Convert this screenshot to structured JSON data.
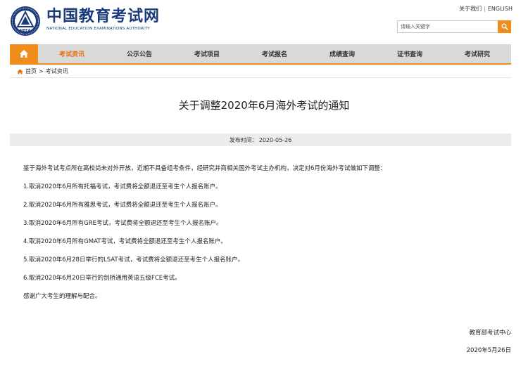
{
  "brand": {
    "name_cn": "中国教育考试网",
    "name_en": "NATIONAL EDUCATION EXAMINATIONS AUTHORITY",
    "logo_initials": "NEEA"
  },
  "toplinks": {
    "about": "关于我们",
    "separator": "|",
    "english": "ENGLISH"
  },
  "search": {
    "placeholder": "请输入关键字"
  },
  "nav": {
    "items": [
      {
        "label": "考试资讯",
        "active": true
      },
      {
        "label": "公示公告",
        "active": false
      },
      {
        "label": "考试项目",
        "active": false
      },
      {
        "label": "考试报名",
        "active": false
      },
      {
        "label": "成绩查询",
        "active": false
      },
      {
        "label": "证书查询",
        "active": false
      },
      {
        "label": "考试研究",
        "active": false
      }
    ]
  },
  "breadcrumb": {
    "home": "首页",
    "separator": ">",
    "current": "考试资讯"
  },
  "article": {
    "title": "关于调整2020年6月海外考试的通知",
    "publish_label": "发布时间：",
    "publish_date": "2020-05-26",
    "paragraphs": [
      "鉴于海外考试考点所在高校尚未对外开放，近期不具备组考条件，经研究并商相关国外考试主办机构，决定对6月份海外考试做如下调整：",
      "1.取消2020年6月所有托福考试，考试费将全额退还至考生个人报名账户。",
      "2.取消2020年6月所有雅思考试，考试费将全额退还至考生个人报名账户。",
      "3.取消2020年6月所有GRE考试，考试费将全额退还至考生个人报名账户。",
      "4.取消2020年6月所有GMAT考试，考试费将全额退还至考生个人报名账户。",
      "5.取消2020年6月28日举行的LSAT考试，考试费将全额退还至考生个人报名账户。",
      "6.取消2020年6月20日举行的剑桥通用英语五级FCE考试。",
      "感谢广大考生的理解与配合。"
    ],
    "signature": "教育部考试中心",
    "sign_date": "2020年5月26日"
  },
  "colors": {
    "accent": "#f08c1c",
    "nav_bg": "#d9d9d9",
    "brand_blue": "#1a3a7a",
    "active_nav_text": "#e5700e"
  },
  "icons": {
    "logo": "neea-emblem-icon",
    "search": "search-icon",
    "home": "home-icon",
    "breadcrumb_home": "home-small-icon"
  }
}
